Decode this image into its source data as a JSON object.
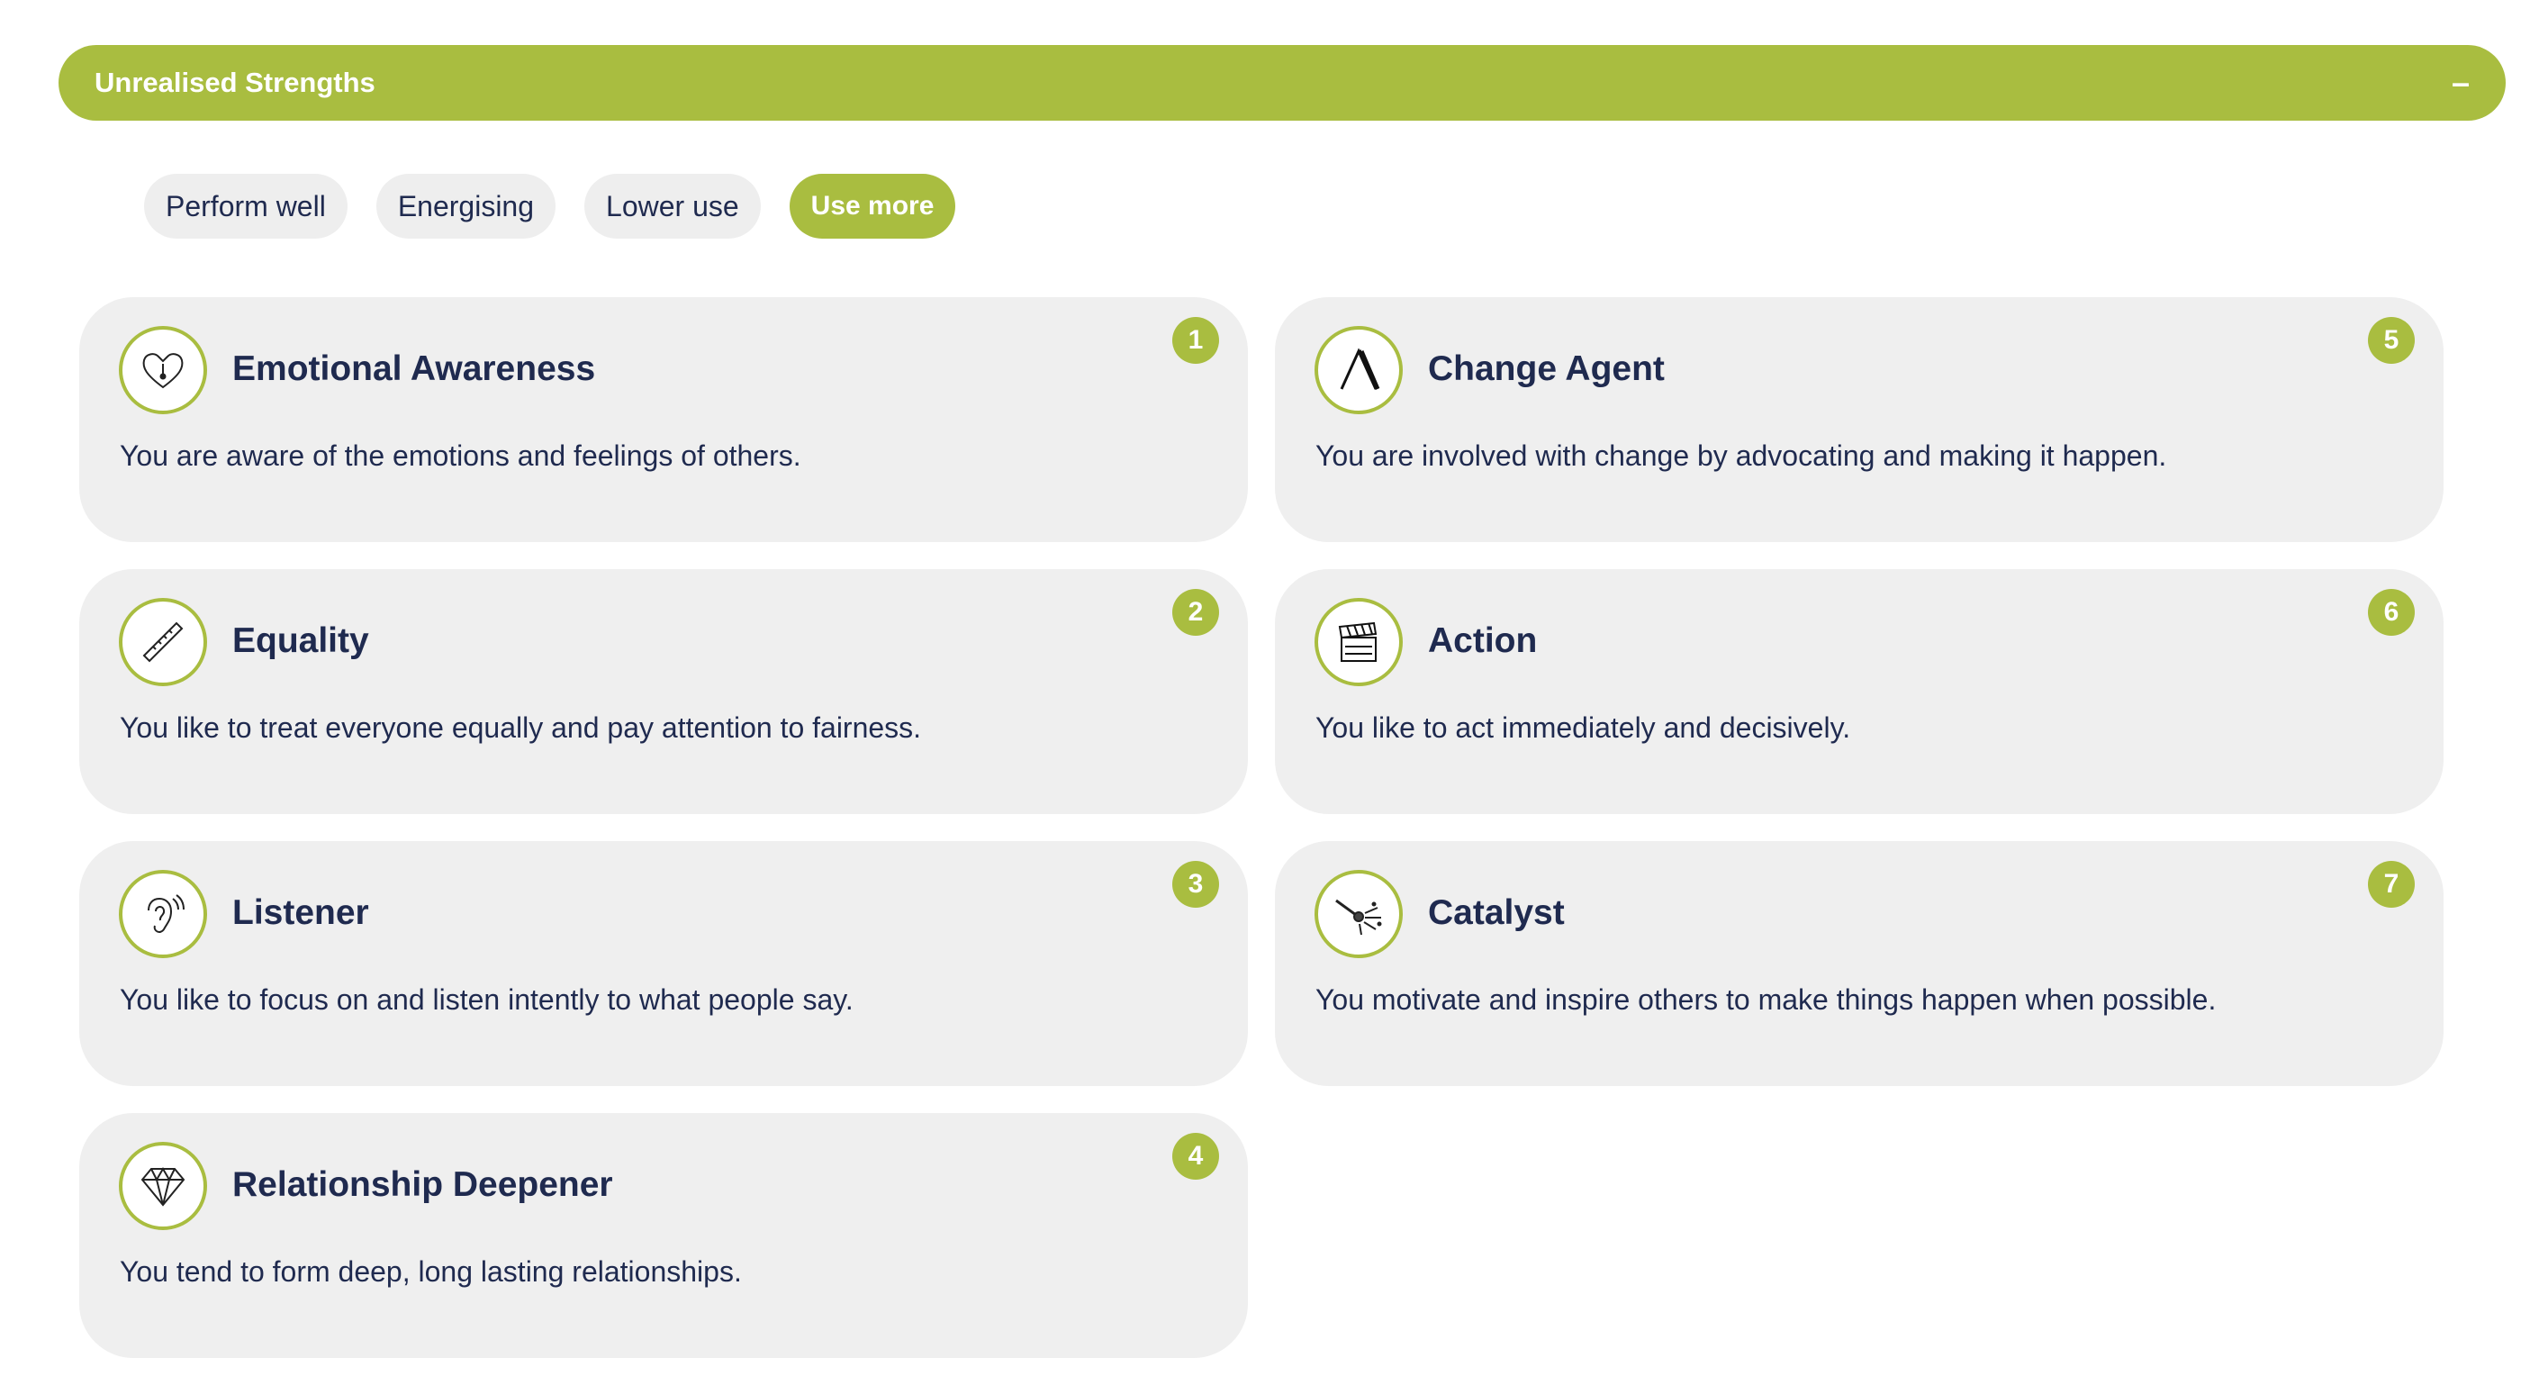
{
  "section": {
    "title": "Unrealised Strengths",
    "collapse_symbol": "–"
  },
  "filters": [
    {
      "label": "Perform well",
      "active": false
    },
    {
      "label": "Energising",
      "active": false
    },
    {
      "label": "Lower use",
      "active": false
    },
    {
      "label": "Use more",
      "active": true
    }
  ],
  "cards": [
    {
      "number": "1",
      "title": "Emotional Awareness",
      "description": "You are aware of the emotions and feelings of others.",
      "icon": "heart-thermometer-icon"
    },
    {
      "number": "2",
      "title": "Equality",
      "description": "You like to treat everyone equally and pay attention to fairness.",
      "icon": "ruler-icon"
    },
    {
      "number": "3",
      "title": "Listener",
      "description": "You like to focus on and listen intently to what people say.",
      "icon": "ear-icon"
    },
    {
      "number": "4",
      "title": "Relationship Deepener",
      "description": "You tend to form deep, long lasting relationships.",
      "icon": "diamond-icon"
    },
    {
      "number": "5",
      "title": "Change Agent",
      "description": "You are involved with change by advocating and making it happen.",
      "icon": "delta-icon"
    },
    {
      "number": "6",
      "title": "Action",
      "description": "You like to act immediately and decisively.",
      "icon": "clapperboard-icon"
    },
    {
      "number": "7",
      "title": "Catalyst",
      "description": "You motivate and inspire others to make things happen when possible.",
      "icon": "match-spark-icon"
    }
  ],
  "colors": {
    "accent": "#a9bd40",
    "card_bg": "#efefef",
    "text": "#1f2a4f"
  }
}
